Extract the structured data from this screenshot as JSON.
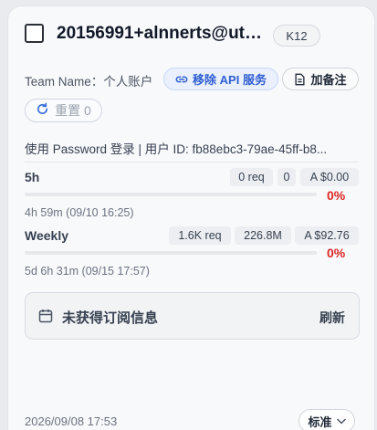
{
  "account": {
    "email": "20156991+alnnerts@utc...",
    "plan_badge": "K12",
    "team_label": "Team Name：个人账户",
    "info_line": "使用 Password 登录 | 用户 ID: fb88ebc3-79ae-45ff-b8..."
  },
  "actions": {
    "remove_api": "移除 API 服务",
    "add_note": "加备注",
    "reset": "重置 0",
    "refresh": "刷新",
    "tier": "标准"
  },
  "usage": [
    {
      "label": "5h",
      "requests": "0 req",
      "tokens": "0",
      "cost": "A $0.00",
      "percent_text": "0%",
      "percent": 0,
      "reset": "4h 59m (09/10 16:25)"
    },
    {
      "label": "Weekly",
      "requests": "1.6K req",
      "tokens": "226.8M",
      "cost": "A $92.76",
      "percent_text": "0%",
      "percent": 0,
      "reset": "5d 6h 31m (09/15 17:57)"
    }
  ],
  "subscription": {
    "status": "未获得订阅信息"
  },
  "footer": {
    "date": "2026/09/08 17:53"
  },
  "colors": {
    "accent_blue": "#2f5fd0",
    "danger_red": "#dc2626"
  },
  "icons": {
    "unlink": "unlink-icon",
    "note": "document-icon",
    "reset": "refresh-icon",
    "calendar": "calendar-icon",
    "chevron": "chevron-down-icon"
  }
}
